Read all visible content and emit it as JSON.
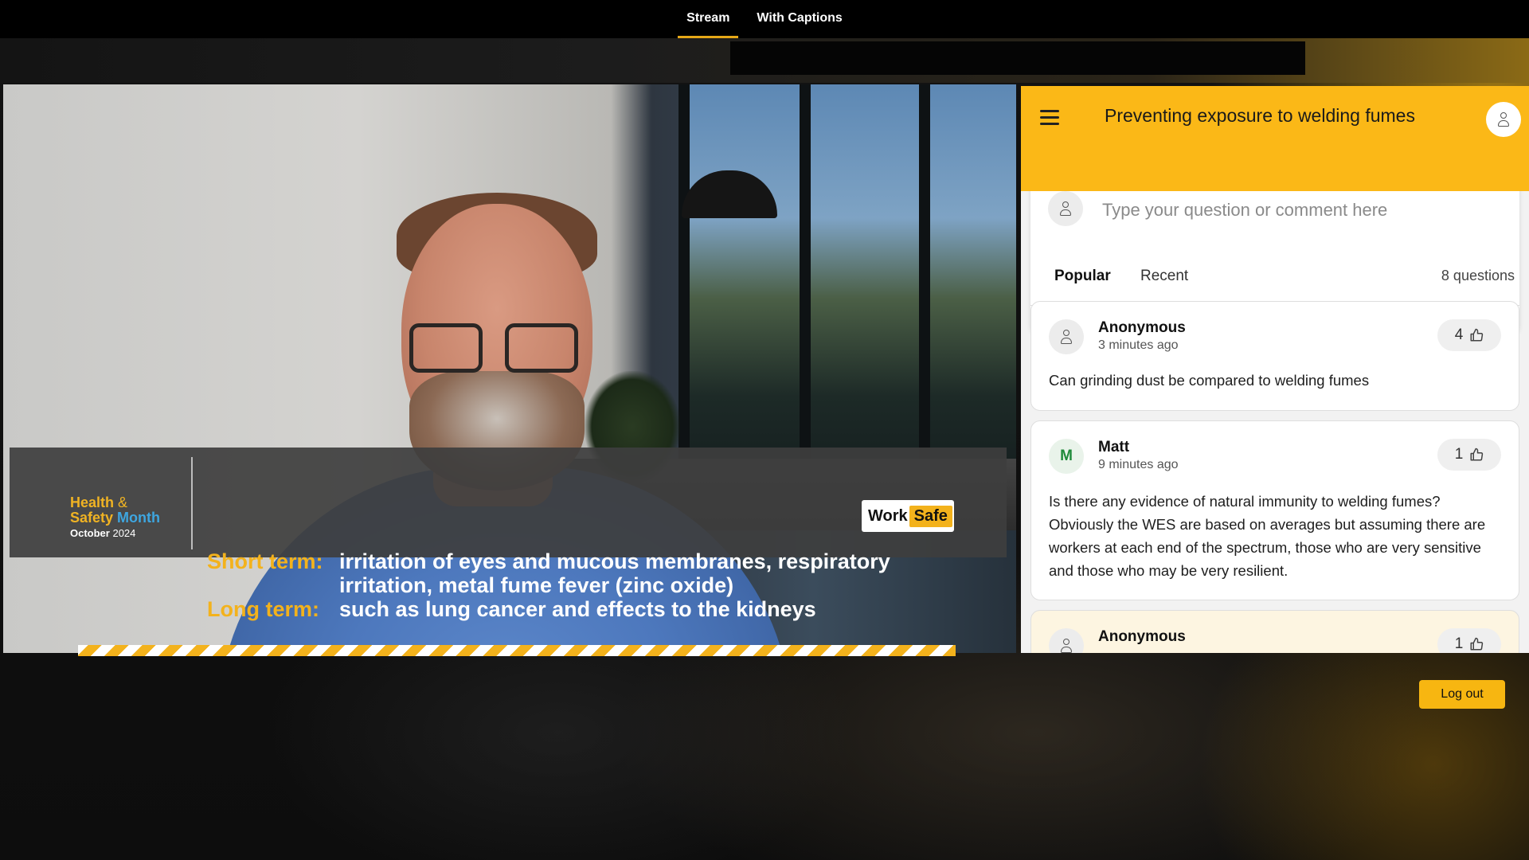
{
  "nav": {
    "tabs": [
      {
        "label": "Stream",
        "active": true
      },
      {
        "label": "With Captions",
        "active": false
      }
    ]
  },
  "video": {
    "caption": {
      "short_term_label": "Short term:",
      "short_term_line1": "irritation of eyes and mucous membranes, respiratory",
      "short_term_line2": "irritation, metal fume fever (zinc oxide)",
      "long_term_label": "Long term:",
      "long_term_text": "such as lung cancer and effects to the kidneys"
    },
    "brand": {
      "line1_a": "Health",
      "line1_b": "&",
      "line2_a": "Safety",
      "line2_b": "Month",
      "date_month": "October",
      "date_year": "2024"
    },
    "logo": {
      "work": "Work",
      "safe": "Safe"
    }
  },
  "qa": {
    "title": "Preventing exposure to welding fumes",
    "input_placeholder": "Type your question or comment here",
    "tabs": [
      {
        "label": "Popular",
        "active": true
      },
      {
        "label": "Recent",
        "active": false
      }
    ],
    "count_label": "8 questions",
    "questions": [
      {
        "author": "Anonymous",
        "time": "3 minutes ago",
        "likes": "4",
        "text": "Can grinding dust be compared to welding fumes"
      },
      {
        "author": "Matt",
        "initial": "M",
        "time": "9 minutes ago",
        "likes": "1",
        "text": "Is there any evidence of natural immunity to welding fumes? Obviously the WES are based on averages but assuming there are workers at each end of the spectrum, those who are very sensitive and those who may be very resilient."
      },
      {
        "author": "Anonymous",
        "likes": "1"
      }
    ]
  },
  "footer": {
    "logout_label": "Log out"
  },
  "colors": {
    "accent_yellow": "#fbb817",
    "caption_yellow": "#f3b21c",
    "brand_blue": "#3ea6e0",
    "avatar_green": "#1e8a3a"
  },
  "icons": [
    "menu-icon",
    "user-icon",
    "thumbs-up-icon"
  ]
}
